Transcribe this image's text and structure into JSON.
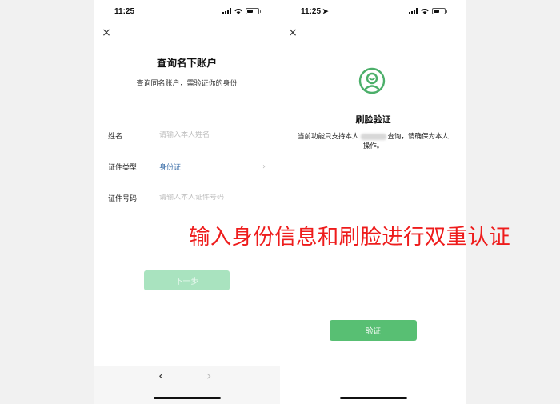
{
  "left_screen": {
    "status_time": "11:25",
    "close_glyph": "×",
    "title": "查询名下账户",
    "subtitle": "查询同名账户，需验证你的身份",
    "fields": [
      {
        "label": "姓名",
        "placeholder": "请输入本人姓名"
      },
      {
        "label": "证件类型",
        "value": "身份证"
      },
      {
        "label": "证件号码",
        "placeholder": "请输入本人证件号码"
      }
    ],
    "next_button": "下一步",
    "nav_back": "‹",
    "nav_forward": "›"
  },
  "right_screen": {
    "status_time": "11:25",
    "location_glyph": "➤",
    "close_glyph": "×",
    "icon": "face-scan-icon",
    "title": "刷脸验证",
    "desc_part1": "当前功能只支持本人",
    "desc_part2": "查询，请确保为本人操作。",
    "verify_button": "验证"
  },
  "overlay_caption": "输入身份信息和刷脸进行双重认证",
  "colors": {
    "accent_green": "#58bf73",
    "disabled_green": "#a9e3bf",
    "link_blue": "#3b6ea8",
    "caption_red": "#ee1c1c"
  },
  "status": {
    "battery_level": 0.5
  }
}
